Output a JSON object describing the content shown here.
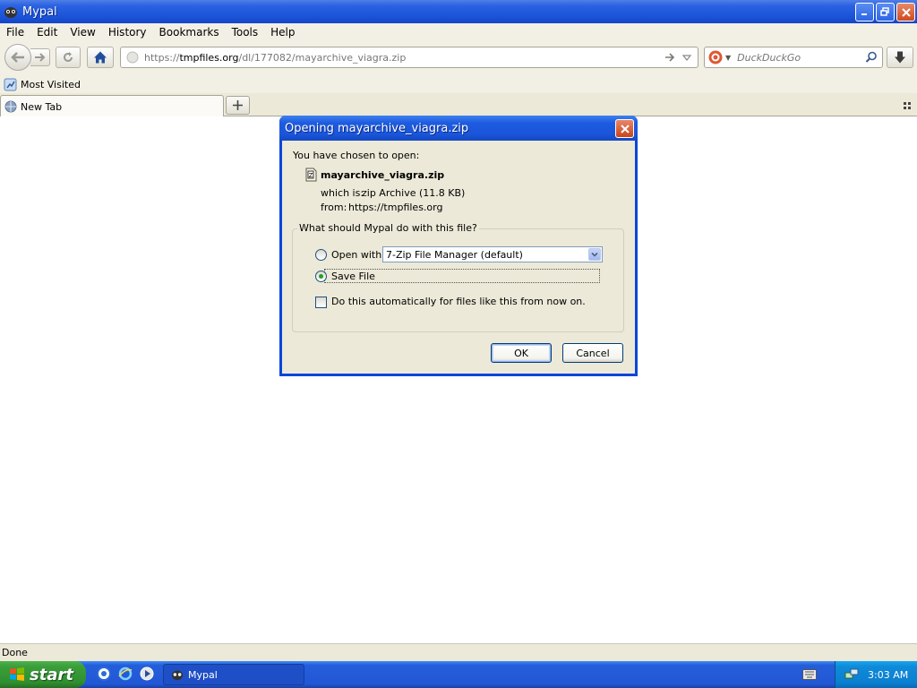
{
  "window": {
    "title": "Mypal"
  },
  "menu": [
    {
      "mnemonic": "F",
      "rest": "ile"
    },
    {
      "mnemonic": "E",
      "rest": "dit"
    },
    {
      "mnemonic": "V",
      "rest": "iew"
    },
    {
      "mnemonic": "",
      "rest": "History",
      "u": "s",
      "pre": "Hi",
      "post": "tory"
    },
    {
      "mnemonic": "B",
      "rest": "ookmarks"
    },
    {
      "mnemonic": "T",
      "rest": "ools"
    },
    {
      "mnemonic": "H",
      "rest": "elp"
    }
  ],
  "menu_labels": [
    "File",
    "Edit",
    "View",
    "History",
    "Bookmarks",
    "Tools",
    "Help"
  ],
  "nav": {
    "url_prefix": "https://",
    "url_host": "tmpfiles.org",
    "url_path": "/dl/177082/mayarchive_viagra.zip",
    "search_placeholder": "DuckDuckGo"
  },
  "bookmarks": {
    "most_visited": "Most Visited"
  },
  "tabs": [
    {
      "label": "New Tab"
    }
  ],
  "status": {
    "text": "Done"
  },
  "dialog": {
    "title": "Opening mayarchive_viagra.zip",
    "intro": "You have chosen to open:",
    "file_name": "mayarchive_viagra.zip",
    "which_is_label": "which is:",
    "which_is_value": "zip Archive (11.8 KB)",
    "from_label": "from:",
    "from_value": "https://tmpfiles.org",
    "question": "What should Mypal do with this file?",
    "open_with_label": "Open with",
    "open_with_app": "7-Zip File Manager (default)",
    "save_file_label": "Save File",
    "auto_label": "Do this automatically for files like this from now on.",
    "ok": "OK",
    "cancel": "Cancel",
    "selected_option": "save"
  },
  "taskbar": {
    "start": "start",
    "task": "Mypal",
    "clock": "3:03 AM"
  },
  "colors": {
    "title_blue": "#1c54d8",
    "taskbar_blue": "#245edb",
    "start_green": "#3a9e3a",
    "tray_blue": "#0f8ad9",
    "dialog_bg": "#ece9d8",
    "close_red": "#d04a1e"
  }
}
